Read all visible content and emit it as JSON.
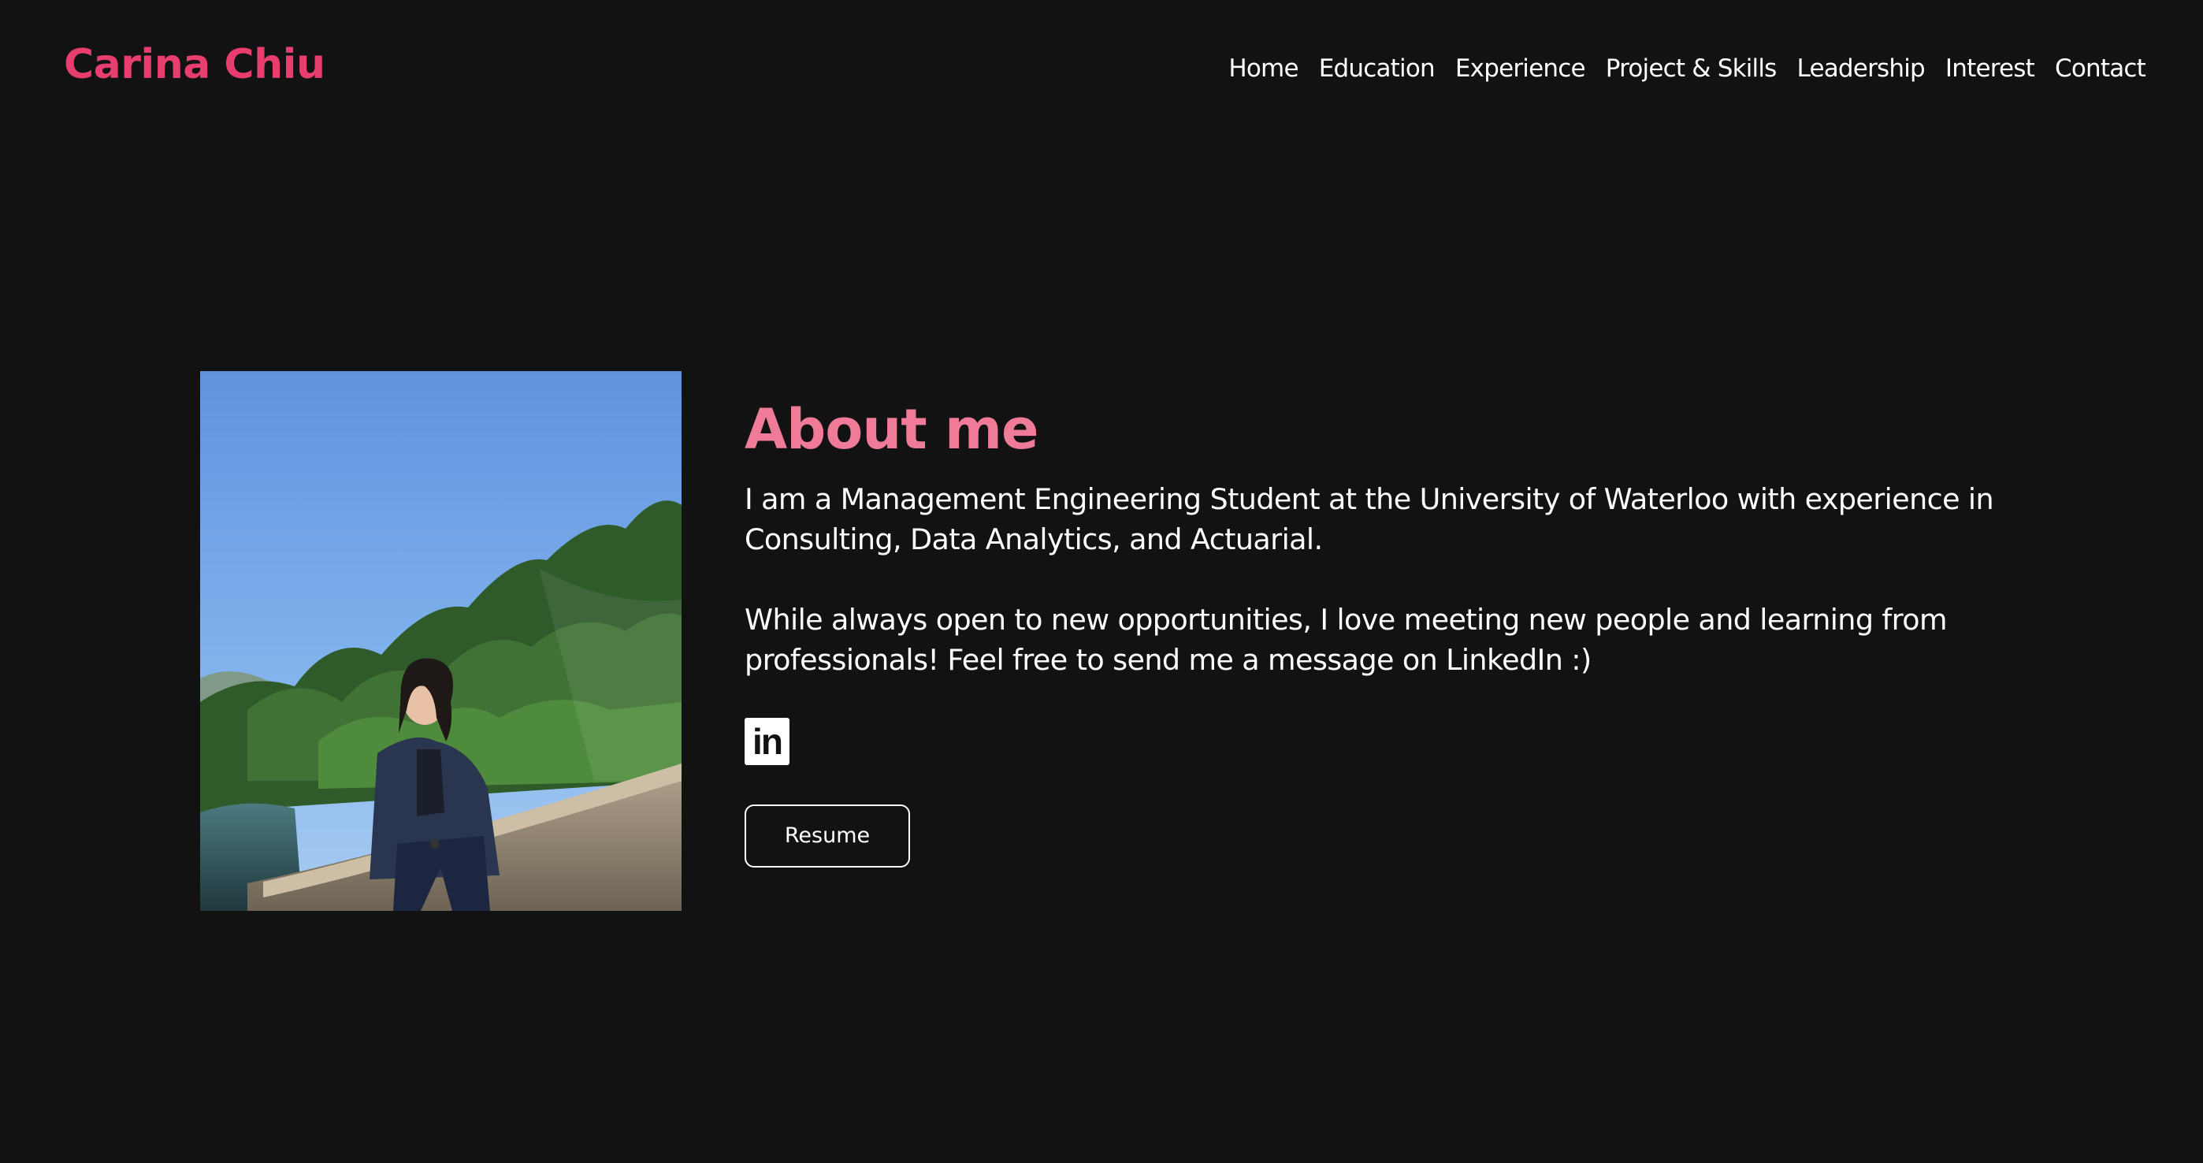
{
  "header": {
    "brand": "Carina Chiu",
    "nav": [
      {
        "label": "Home"
      },
      {
        "label": "Education"
      },
      {
        "label": "Experience"
      },
      {
        "label": "Project & Skills"
      },
      {
        "label": "Leadership"
      },
      {
        "label": "Interest"
      },
      {
        "label": "Contact"
      }
    ]
  },
  "about": {
    "title": "About me",
    "paragraph1": "I am a Management Engineering Student at the University of Waterloo with experience in Consulting, Data Analytics, and Actuarial.",
    "paragraph2": "While always open to new opportunities, I love meeting new people and learning from professionals! Feel free to send me a message on LinkedIn :)",
    "linkedin_icon": "in",
    "resume_label": "Resume"
  },
  "colors": {
    "background": "#121212",
    "brand": "#e83e6f",
    "heading": "#ef7b99",
    "text": "#ffffff"
  },
  "icons": {
    "linkedin": "linkedin-icon"
  }
}
